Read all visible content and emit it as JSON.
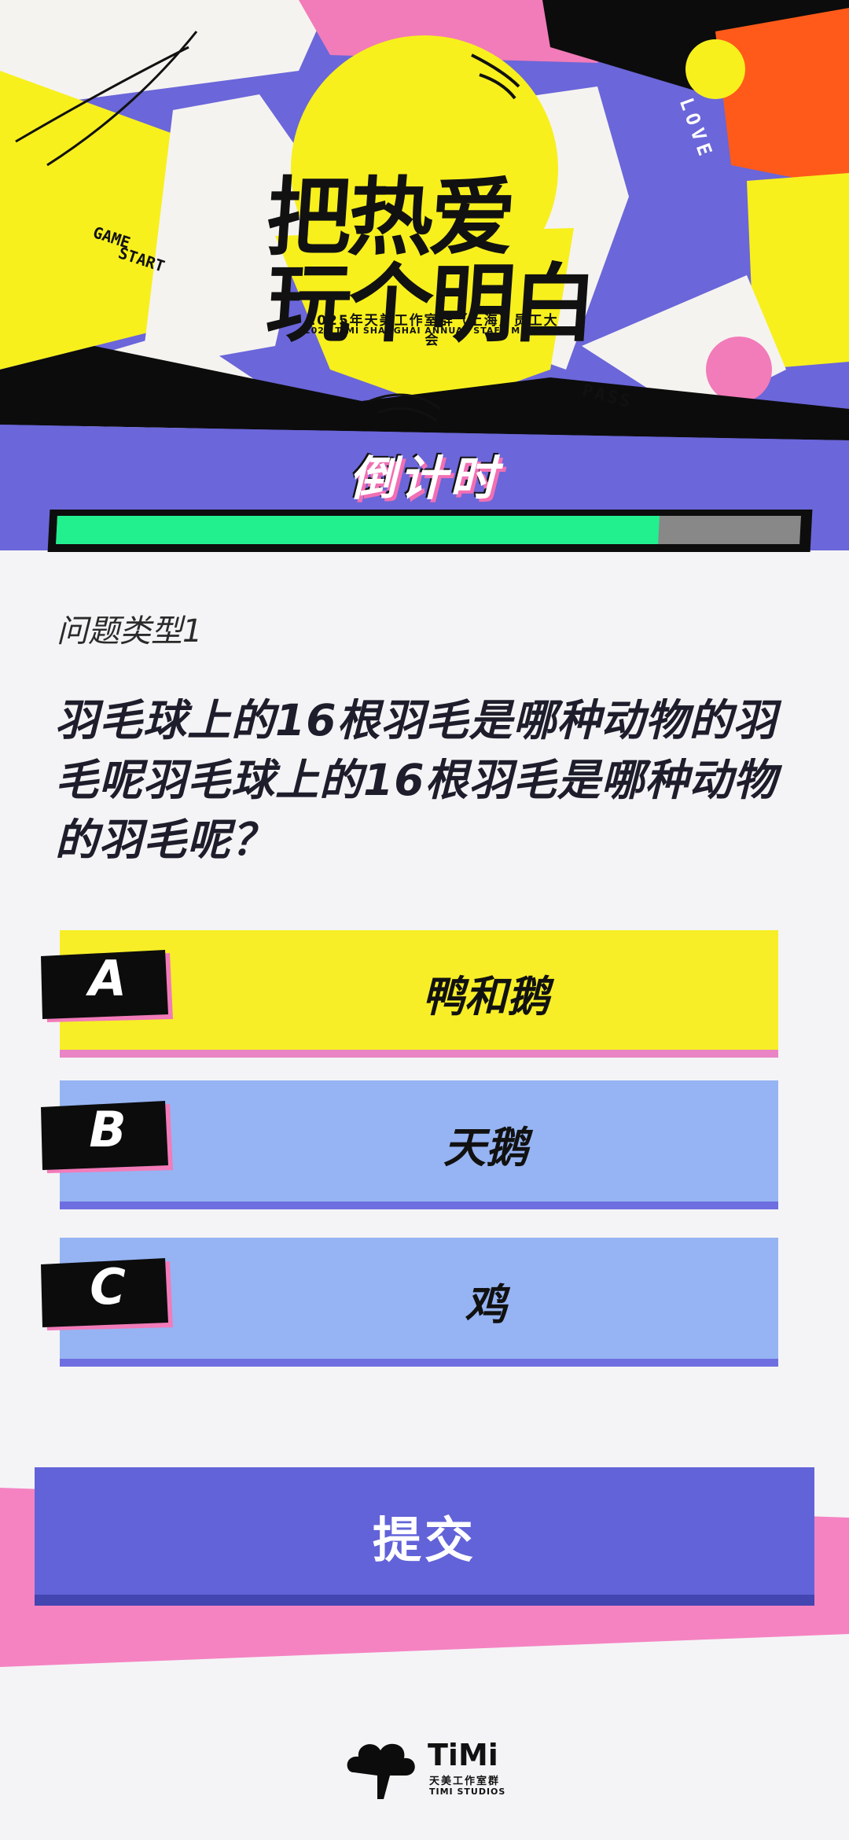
{
  "hero": {
    "title_line1": "把热爱",
    "title_line2": "玩个明白",
    "subtitle_cn": "2025年天美工作室群（上海）员工大会",
    "subtitle_en": "2025 TIMI SHANGHAI ANNUAL STAFF MEETING",
    "tag_game": "GAME",
    "tag_start": "START",
    "tag_love": "LOVE",
    "tag_pass": "PASS"
  },
  "countdown": {
    "title": "倒计时",
    "progress_fraction": 0.81,
    "fill_color": "#22f08f"
  },
  "question": {
    "type_label": "问题类型1",
    "text": "羽毛球上的16根羽毛是哪种动物的羽毛呢羽毛球上的16根羽毛是哪种动物的羽毛呢？"
  },
  "options": [
    {
      "letter": "A",
      "text": "鸭和鹅",
      "state": "selected",
      "color": "#f7ee27",
      "shade_color": "#e985c4"
    },
    {
      "letter": "B",
      "text": "天鹅",
      "state": "default",
      "color": "#96b4f3",
      "shade_color": "#6e6ee0"
    },
    {
      "letter": "C",
      "text": "鸡",
      "state": "default",
      "color": "#96b4f3",
      "shade_color": "#6e6ee0"
    }
  ],
  "submit": {
    "label": "提交",
    "color": "#6263d8"
  },
  "footer": {
    "logo_name": "TiMi",
    "logo_cn": "天美工作室群",
    "logo_en": "TIMI STUDIOS",
    "logo_icon": "cloud-logo-icon"
  }
}
